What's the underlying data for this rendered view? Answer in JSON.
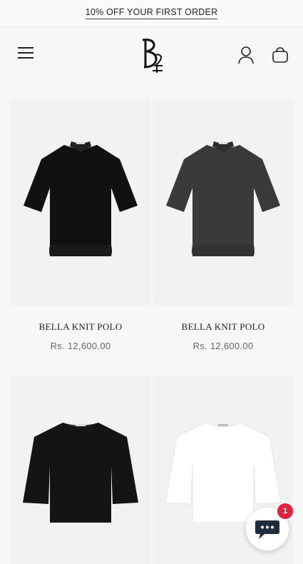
{
  "announcement": {
    "text": "10% OFF YOUR FIRST ORDER"
  },
  "header": {
    "menu_icon": "hamburger-icon",
    "logo_icon": "b25-monogram-logo",
    "account_icon": "user-icon",
    "cart_icon": "bag-icon"
  },
  "products": [
    {
      "title": "BELLA KNIT POLO",
      "price": "Rs. 12,600.00",
      "garment": "polo",
      "color": "#111111"
    },
    {
      "title": "BELLA KNIT POLO",
      "price": "Rs. 12,600.00",
      "garment": "polo",
      "color": "#3a3a3a"
    },
    {
      "garment": "tee",
      "color": "#141414"
    },
    {
      "garment": "tee",
      "color": "#ffffff"
    }
  ],
  "chat": {
    "icon": "chat-icon",
    "badge_count": "1"
  }
}
